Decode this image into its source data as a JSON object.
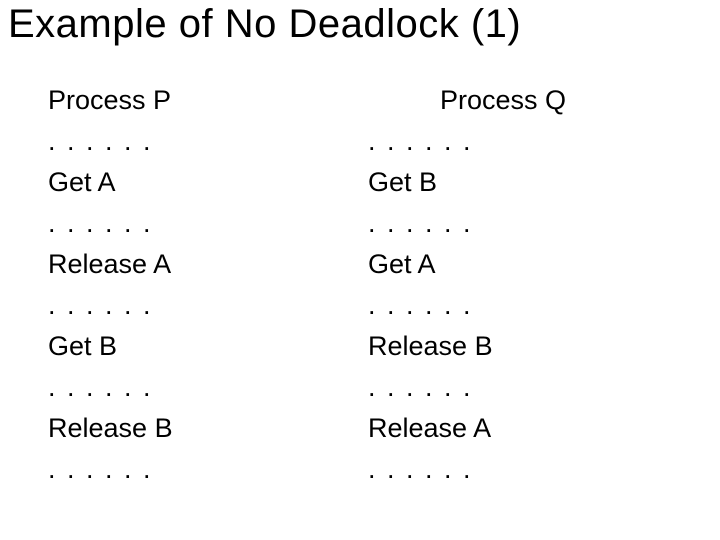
{
  "title": "Example of No Deadlock (1)",
  "ellipsis": ". . . . . .",
  "left": {
    "header": "Process P",
    "lines": [
      "Get A",
      "Release A",
      "Get B",
      "Release B"
    ]
  },
  "right": {
    "header": "Process Q",
    "lines": [
      "Get B",
      "Get A",
      "Release B",
      "Release A"
    ]
  }
}
